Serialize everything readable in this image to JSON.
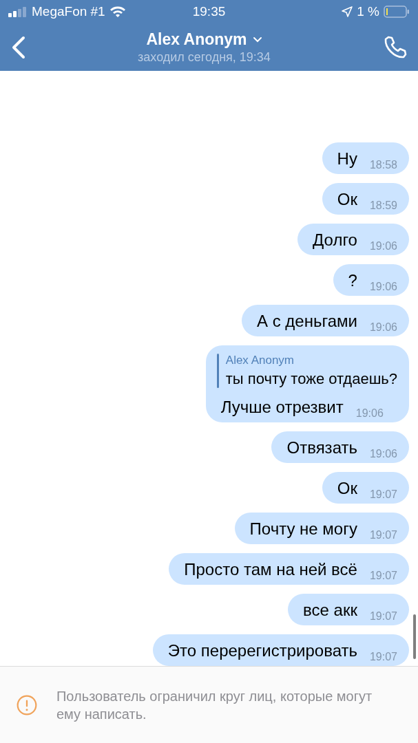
{
  "status_bar": {
    "carrier": "MegaFon #1",
    "time": "19:35",
    "battery": "1 %"
  },
  "header": {
    "title": "Alex Anonym",
    "subtitle": "заходил сегодня, 19:34"
  },
  "messages": [
    {
      "kind": "text",
      "text": "Ну",
      "time": "18:58"
    },
    {
      "kind": "text",
      "text": "Ок",
      "time": "18:59"
    },
    {
      "kind": "text",
      "text": "Долго",
      "time": "19:06"
    },
    {
      "kind": "text",
      "text": "?",
      "time": "19:06"
    },
    {
      "kind": "text",
      "text": "А с деньгами",
      "time": "19:06"
    },
    {
      "kind": "reply",
      "reply_author": "Alex Anonym",
      "reply_text": "ты почту тоже отдаешь?",
      "text": "Лучше отрезвит",
      "time": "19:06"
    },
    {
      "kind": "text",
      "text": "Отвязать",
      "time": "19:06"
    },
    {
      "kind": "text",
      "text": "Ок",
      "time": "19:07"
    },
    {
      "kind": "text",
      "text": "Почту не могу",
      "time": "19:07"
    },
    {
      "kind": "text",
      "text": "Просто там на ней всё",
      "time": "19:07"
    },
    {
      "kind": "text",
      "text": "все акк",
      "time": "19:07"
    },
    {
      "kind": "text",
      "text": "Это перерегистрировать",
      "time": "19:07"
    }
  ],
  "notice": {
    "text": "Пользователь ограничил круг лиц, которые могут ему написать."
  }
}
